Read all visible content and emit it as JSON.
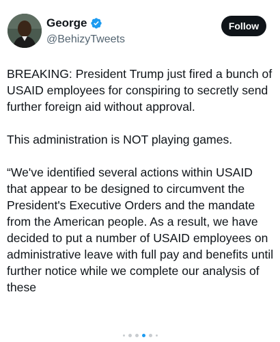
{
  "author": {
    "display_name": "George",
    "handle": "@BehizyTweets",
    "verified": true,
    "avatar_icon": "profile-photo"
  },
  "actions": {
    "follow_label": "Follow"
  },
  "tweet": {
    "paragraphs": [
      "BREAKING: President Trump just fired a bunch of USAID employees for conspiring to secretly send further foreign aid without approval.",
      "This administration is NOT playing games.",
      "“We've identified several actions within USAID that appear to be designed to circumvent the President's Executive Orders and the mandate from the American people. As a result, we have decided to put a number of USAID employees on administrative leave with full pay and benefits until further notice while we complete our analysis of these"
    ]
  },
  "pager": {
    "total": 6,
    "active_index": 3
  },
  "colors": {
    "verified": "#1d9bf0",
    "follow_bg": "#0f1419",
    "handle": "#536471"
  }
}
